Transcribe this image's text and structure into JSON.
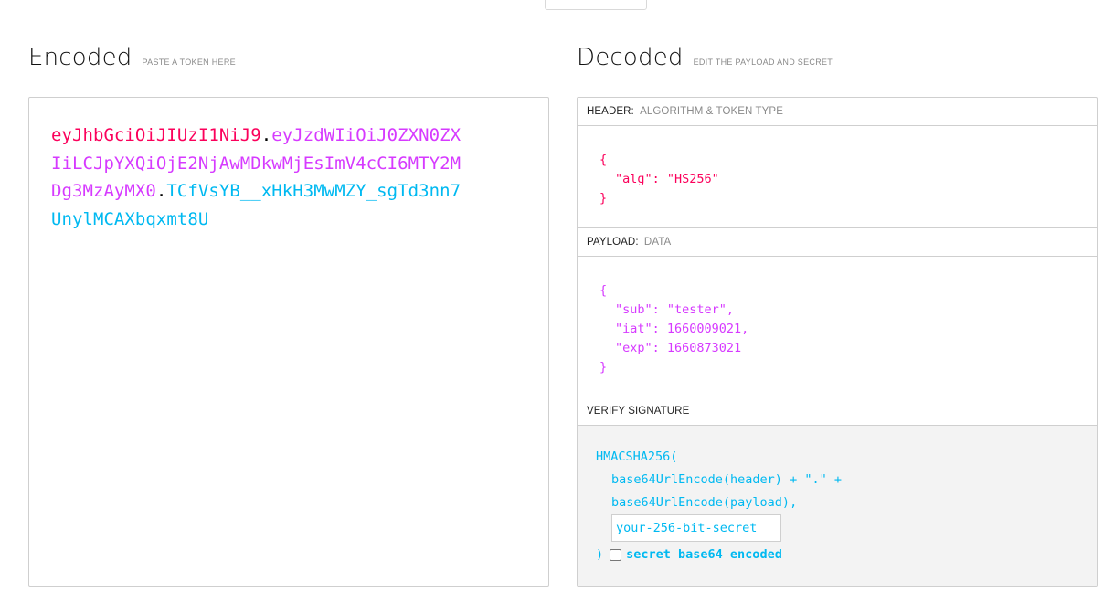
{
  "encoded": {
    "title": "Encoded",
    "subtitle": "PASTE A TOKEN HERE",
    "token_lines": [
      [
        {
          "part": "header",
          "text": "eyJhbGciOiJIUzI1NiJ9"
        },
        {
          "part": "dot",
          "text": "."
        },
        {
          "part": "payload",
          "text": "eyJzdWIiOiJ0ZXN0ZX"
        }
      ],
      [
        {
          "part": "payload",
          "text": "IiLCJpYXQiOjE2NjAwMDkwMjEsImV4cCI6MTY2M"
        }
      ],
      [
        {
          "part": "payload",
          "text": "Dg3MzAyMX0"
        },
        {
          "part": "dot",
          "text": "."
        },
        {
          "part": "sig",
          "text": "TCfVsYB__xHkH3MwMZY_sgTd3nn7"
        }
      ],
      [
        {
          "part": "sig",
          "text": "UnylMCAXbqxmt8U"
        }
      ]
    ]
  },
  "decoded": {
    "title": "Decoded",
    "subtitle": "EDIT THE PAYLOAD AND SECRET",
    "header": {
      "label": "HEADER:",
      "hint": "ALGORITHM & TOKEN TYPE",
      "open": "{",
      "lines": [
        "\"alg\": \"HS256\""
      ],
      "close": "}"
    },
    "payload": {
      "label": "PAYLOAD:",
      "hint": "DATA",
      "open": "{",
      "lines": [
        "\"sub\": \"tester\",",
        "\"iat\": 1660009021,",
        "\"exp\": 1660873021"
      ],
      "close": "}"
    },
    "signature": {
      "label": "VERIFY SIGNATURE",
      "fn_open": "HMACSHA256(",
      "line1": "base64UrlEncode(header) + \".\" +",
      "line2": "base64UrlEncode(payload),",
      "secret_placeholder": "your-256-bit-secret",
      "fn_close": ")",
      "b64_label": "secret base64 encoded",
      "b64_checked": false
    }
  },
  "colors": {
    "header": "#fb015b",
    "payload": "#d63aff",
    "signature": "#00b9f1"
  }
}
